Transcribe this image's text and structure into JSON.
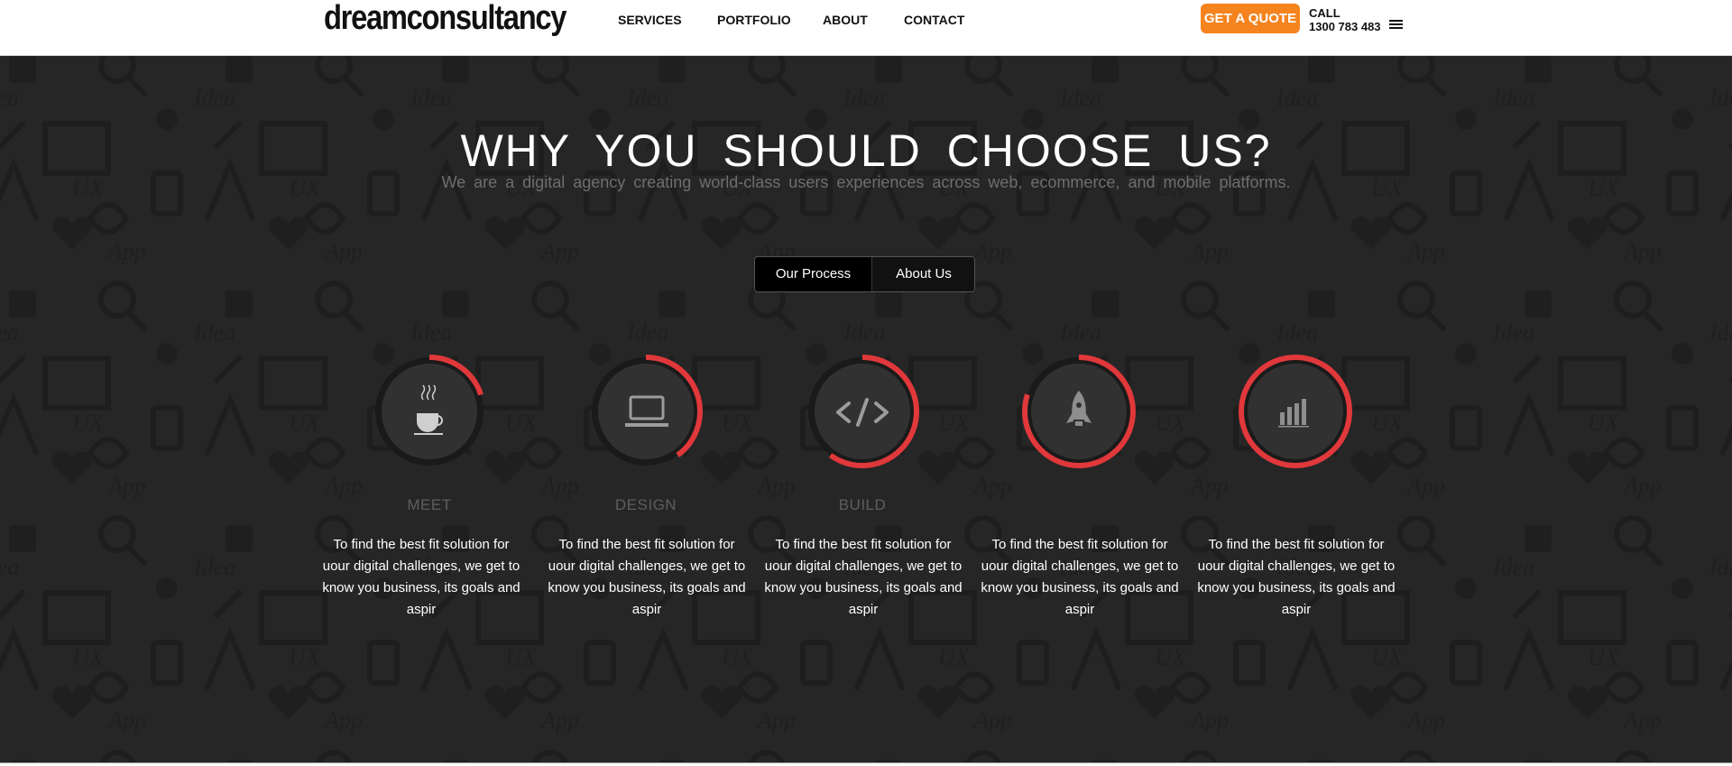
{
  "header": {
    "logo": "dreamconsultancy",
    "nav": [
      "SERVICES",
      "PORTFOLIO",
      "ABOUT",
      "CONTACT"
    ],
    "quote_button": "GET A QUOTE",
    "call_label": "CALL",
    "call_number": "1300 783 483",
    "menu_icon": "hamburger-menu-icon"
  },
  "hero": {
    "title": "WHY YOU SHOULD CHOOSE US?",
    "subtitle": "We are a digital agency creating world-class users experiences across web, ecommerce, and mobile platforms.",
    "tabs": [
      "Our Process",
      "About Us"
    ],
    "active_tab": "Our Process"
  },
  "steps": [
    {
      "title": "MEET",
      "icon": "coffee-cup-icon",
      "progress": 0.2,
      "description": "To find the best fit solution for uour digital challenges, we get to know you business, its goals and aspir"
    },
    {
      "title": "DESIGN",
      "icon": "laptop-icon",
      "progress": 0.4,
      "description": "To find the best fit solution for uour digital challenges, we get to know you business, its goals and aspir"
    },
    {
      "title": "BUILD",
      "icon": "code-icon",
      "progress": 0.6,
      "description": "To find the best fit solution for uour digital challenges, we get to know you business, its goals and aspir"
    },
    {
      "title": "",
      "icon": "rocket-icon",
      "progress": 0.8,
      "description": "To find the best fit solution for uour digital challenges, we get to know you business, its goals and aspir"
    },
    {
      "title": "",
      "icon": "bar-chart-icon",
      "progress": 1.0,
      "description": "To find the best fit solution for uour digital challenges, we get to know you business, its goals and aspir"
    }
  ],
  "colors": {
    "accent_orange": "#f5841f",
    "progress_red": "#e0383b",
    "ring_track": "#1a1a1a",
    "hero_background": "#262626"
  }
}
